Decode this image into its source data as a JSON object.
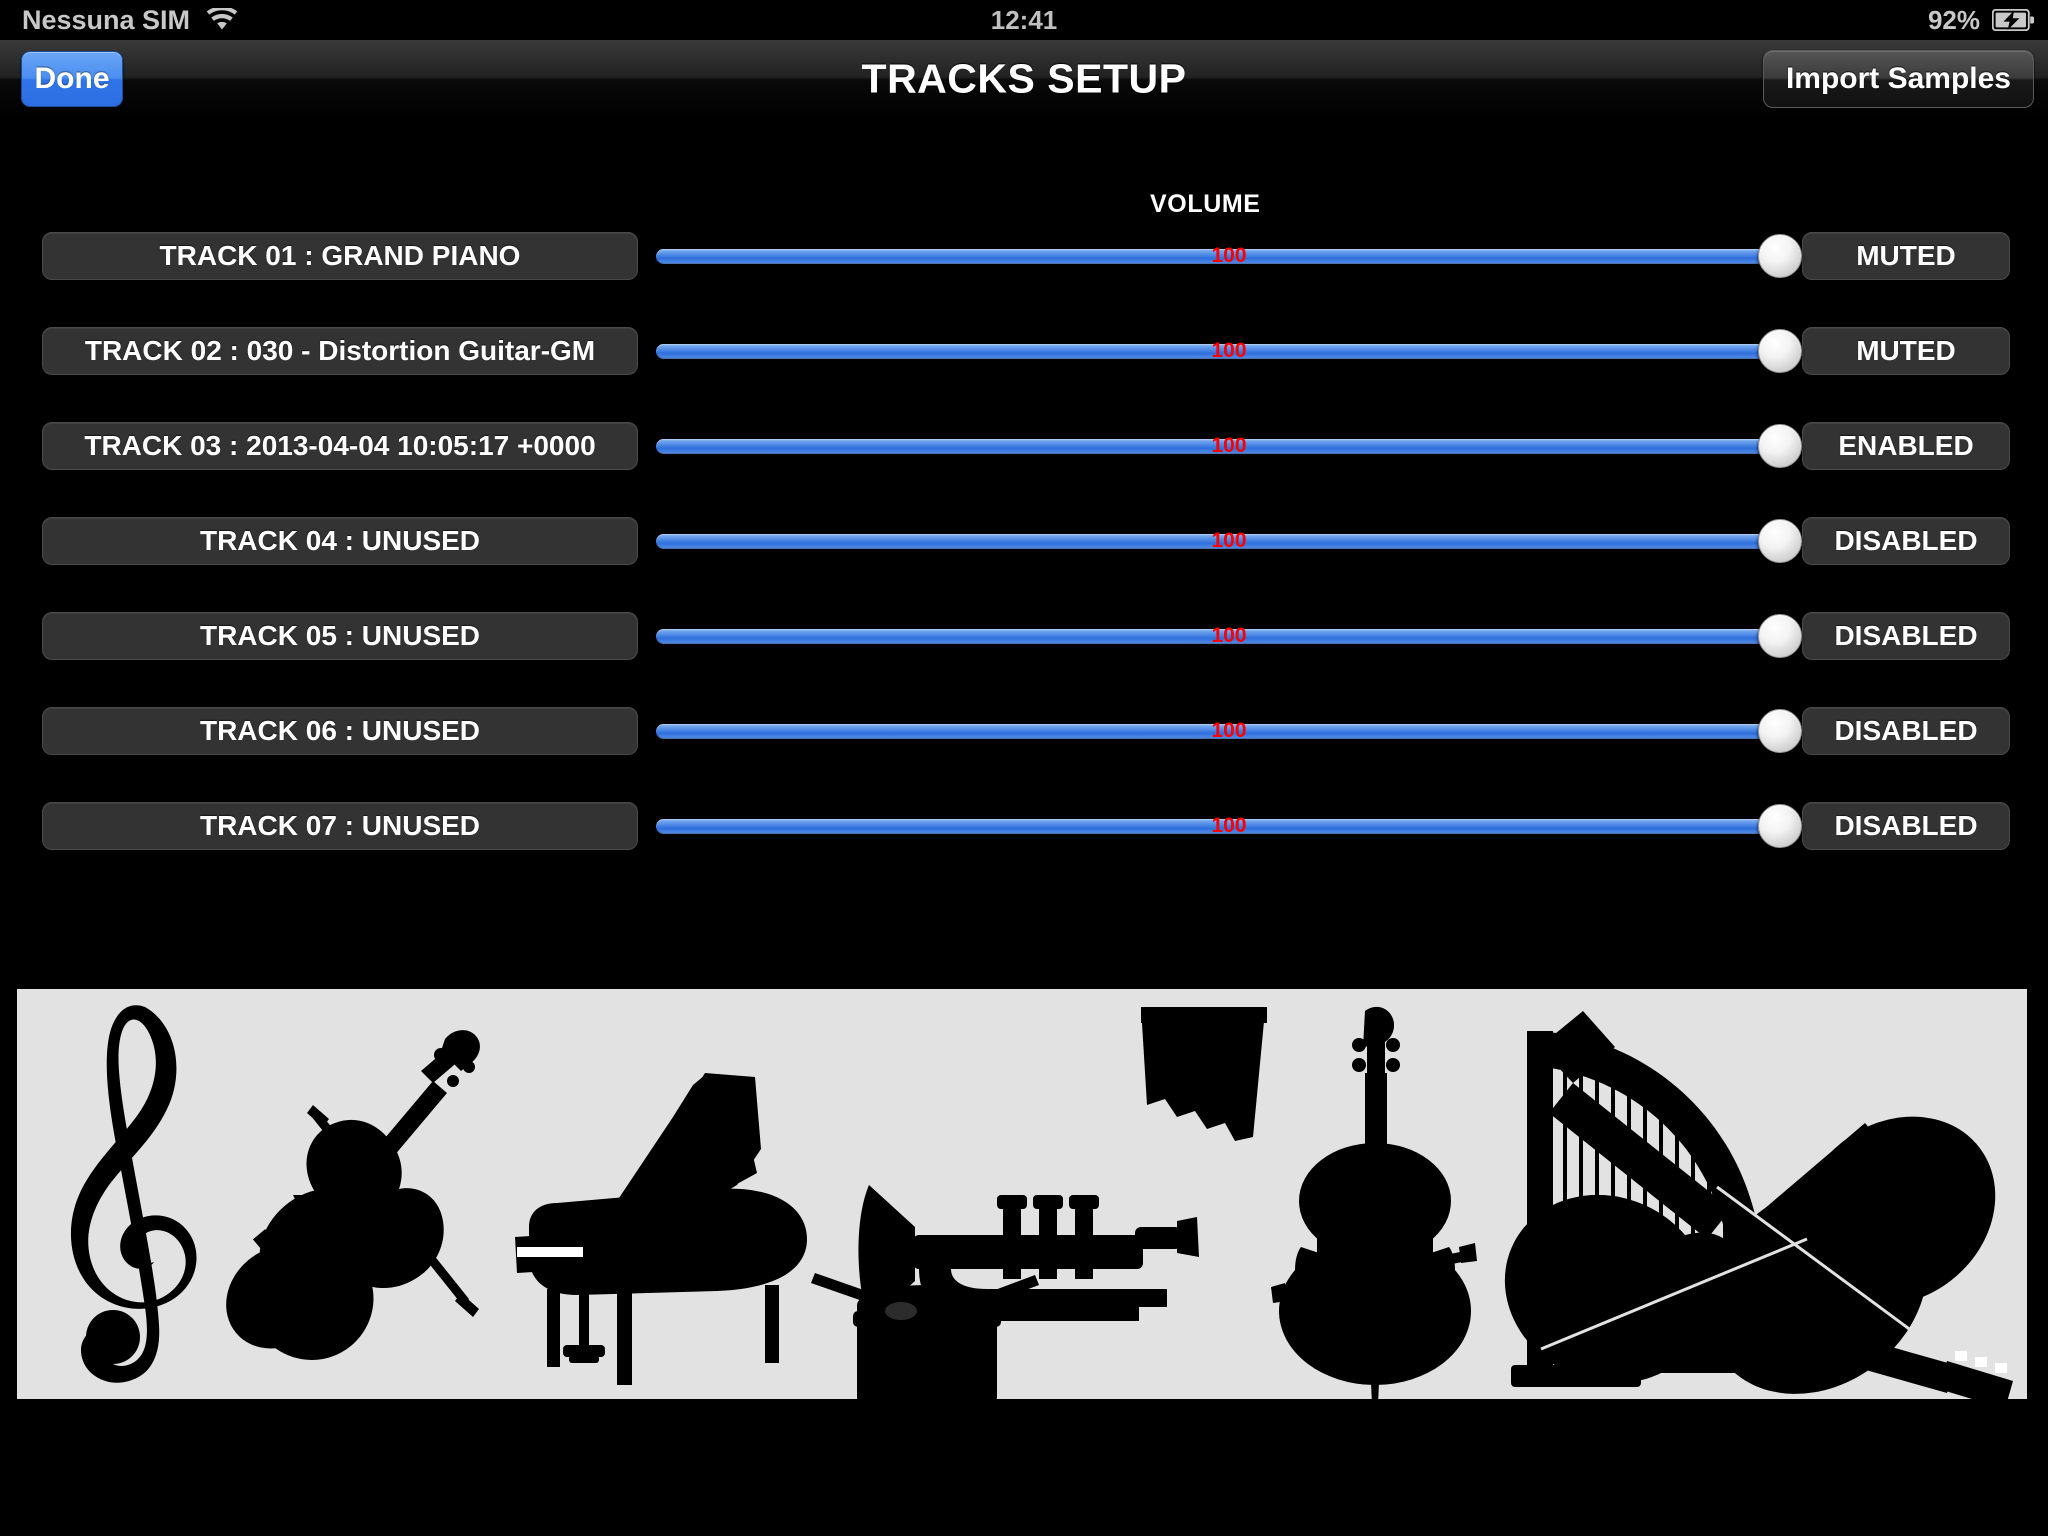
{
  "status_bar": {
    "carrier": "Nessuna SIM",
    "wifi_icon": "wifi-icon",
    "time": "12:41",
    "battery_percent": "92%",
    "battery_icon": "battery-charging-icon"
  },
  "nav_bar": {
    "done_label": "Done",
    "title": "TRACKS SETUP",
    "import_samples_label": "Import Samples"
  },
  "main": {
    "volume_header": "VOLUME",
    "tracks": [
      {
        "name": "TRACK 01 : GRAND PIANO",
        "volume": "100",
        "status": "MUTED"
      },
      {
        "name": "TRACK 02 : 030 - Distortion Guitar-GM",
        "volume": "100",
        "status": "MUTED"
      },
      {
        "name": "TRACK 03 : 2013-04-04 10:05:17 +0000",
        "volume": "100",
        "status": "ENABLED"
      },
      {
        "name": "TRACK 04 : UNUSED",
        "volume": "100",
        "status": "DISABLED"
      },
      {
        "name": "TRACK 05 : UNUSED",
        "volume": "100",
        "status": "DISABLED"
      },
      {
        "name": "TRACK 06 : UNUSED",
        "volume": "100",
        "status": "DISABLED"
      },
      {
        "name": "TRACK 07 : UNUSED",
        "volume": "100",
        "status": "DISABLED"
      }
    ]
  },
  "instruments_panel": {
    "background_color": "#e2e2e2",
    "silhouettes": [
      "treble-clef-icon",
      "violin-icon",
      "grand-piano-icon",
      "drum-icon",
      "pan-flute-icon",
      "trumpet-icon",
      "cello-icon",
      "harp-icon",
      "acoustic-guitar-icon",
      "electric-guitar-icon"
    ]
  },
  "colors": {
    "accent_blue": "#2f74e8",
    "slider_blue": "#5f97ea",
    "volume_value_red": "#ff0000",
    "button_gray": "#333333",
    "panel_gray": "#e2e2e2"
  }
}
